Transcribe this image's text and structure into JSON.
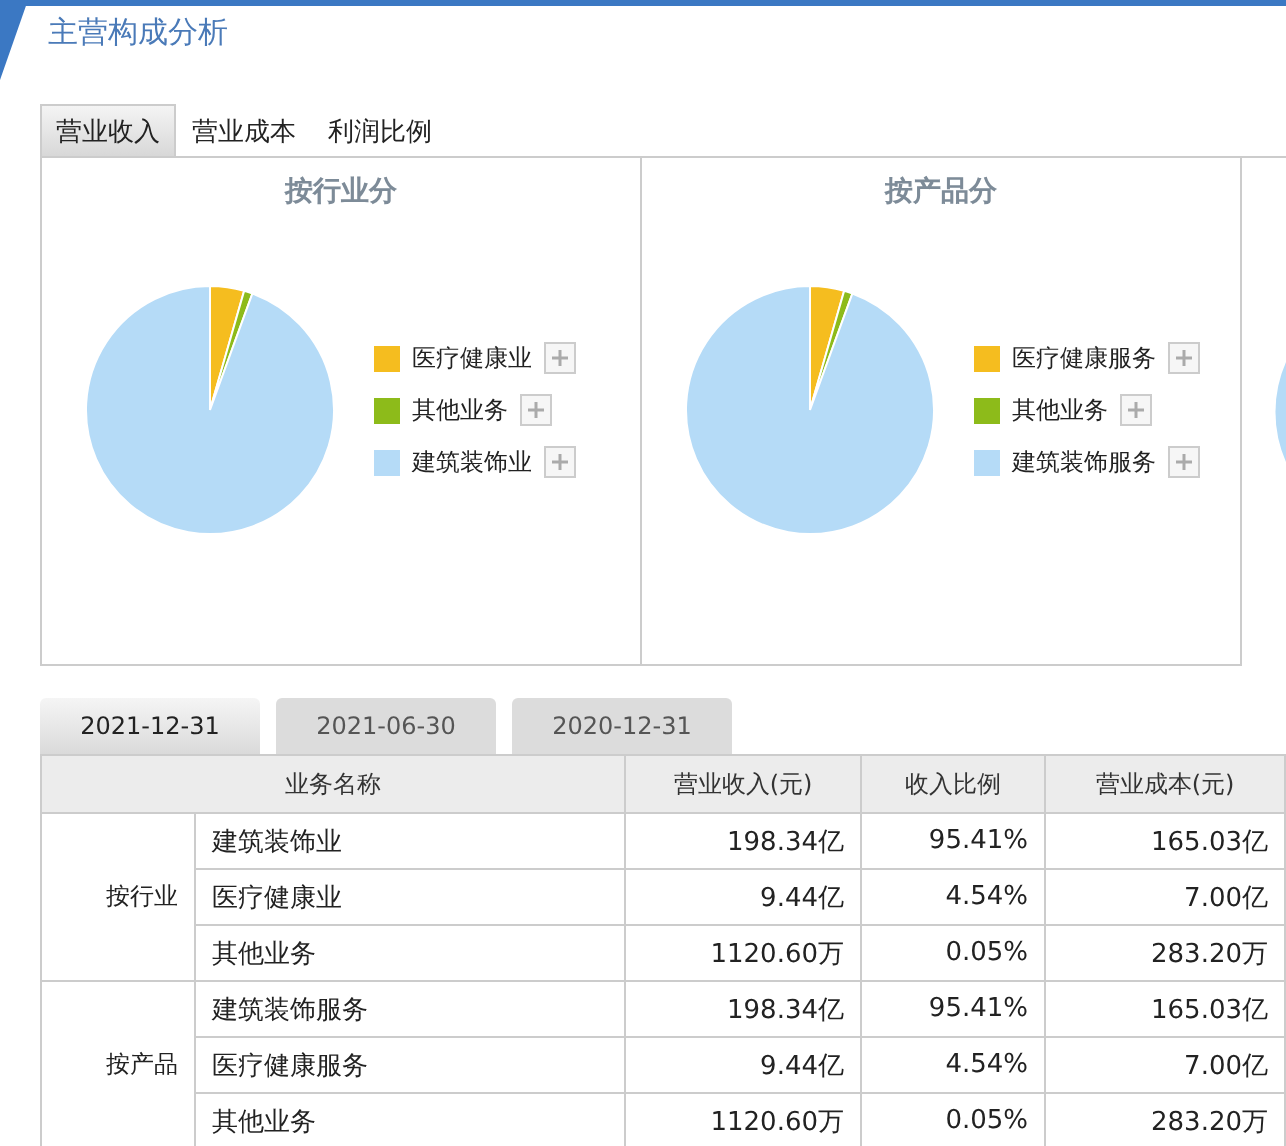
{
  "title": "主营构成分析",
  "tabs": [
    {
      "label": "营业收入",
      "selected": true
    },
    {
      "label": "营业成本",
      "selected": false
    },
    {
      "label": "利润比例",
      "selected": false
    }
  ],
  "charts": [
    {
      "title": "按行业分",
      "legend": [
        {
          "label": "医疗健康业",
          "color": "#f5bd1f"
        },
        {
          "label": "其他业务",
          "color": "#8dbb1a"
        },
        {
          "label": "建筑装饰业",
          "color": "#b5dbf7"
        }
      ]
    },
    {
      "title": "按产品分",
      "legend": [
        {
          "label": "医疗健康服务",
          "color": "#f5bd1f"
        },
        {
          "label": "其他业务",
          "color": "#8dbb1a"
        },
        {
          "label": "建筑装饰服务",
          "color": "#b5dbf7"
        }
      ]
    }
  ],
  "date_tabs": [
    {
      "label": "2021-12-31",
      "selected": true
    },
    {
      "label": "2021-06-30",
      "selected": false
    },
    {
      "label": "2020-12-31",
      "selected": false
    }
  ],
  "table": {
    "columns": [
      "业务名称",
      "营业收入(元)",
      "收入比例",
      "营业成本(元)"
    ],
    "groups": [
      {
        "label": "按行业",
        "rows": [
          [
            "建筑装饰业",
            "198.34亿",
            "95.41%",
            "165.03亿"
          ],
          [
            "医疗健康业",
            "9.44亿",
            "4.54%",
            "7.00亿"
          ],
          [
            "其他业务",
            "1120.60万",
            "0.05%",
            "283.20万"
          ]
        ]
      },
      {
        "label": "按产品",
        "rows": [
          [
            "建筑装饰服务",
            "198.34亿",
            "95.41%",
            "165.03亿"
          ],
          [
            "医疗健康服务",
            "9.44亿",
            "4.54%",
            "7.00亿"
          ],
          [
            "其他业务",
            "1120.60万",
            "0.05%",
            "283.20万"
          ]
        ]
      }
    ]
  }
}
